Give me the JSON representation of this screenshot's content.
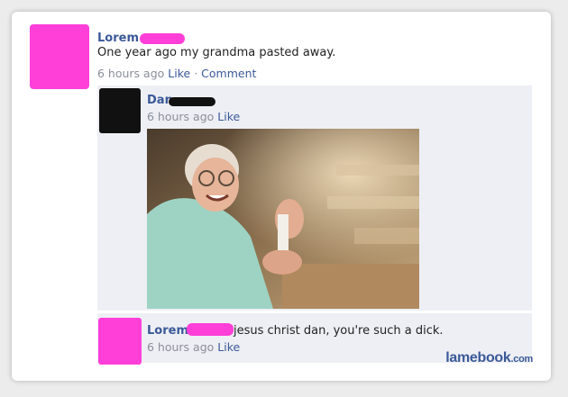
{
  "post": {
    "author": "Lorem",
    "text": "One year ago my grandma pasted away.",
    "time": "6 hours ago",
    "like": "Like",
    "separator": "·",
    "comment": "Comment"
  },
  "comments": [
    {
      "author": "Dan",
      "time": "6 hours ago",
      "like": "Like"
    },
    {
      "author": "Lorem",
      "text": "jesus christ dan, you're such a dick.",
      "time": "6 hours ago",
      "like": "Like"
    }
  ],
  "watermark": {
    "main": "lamebook",
    "suffix": ".com"
  },
  "colors": {
    "link": "#3b5998",
    "redaction": "#ff3fd8",
    "panel": "#edeff4"
  }
}
